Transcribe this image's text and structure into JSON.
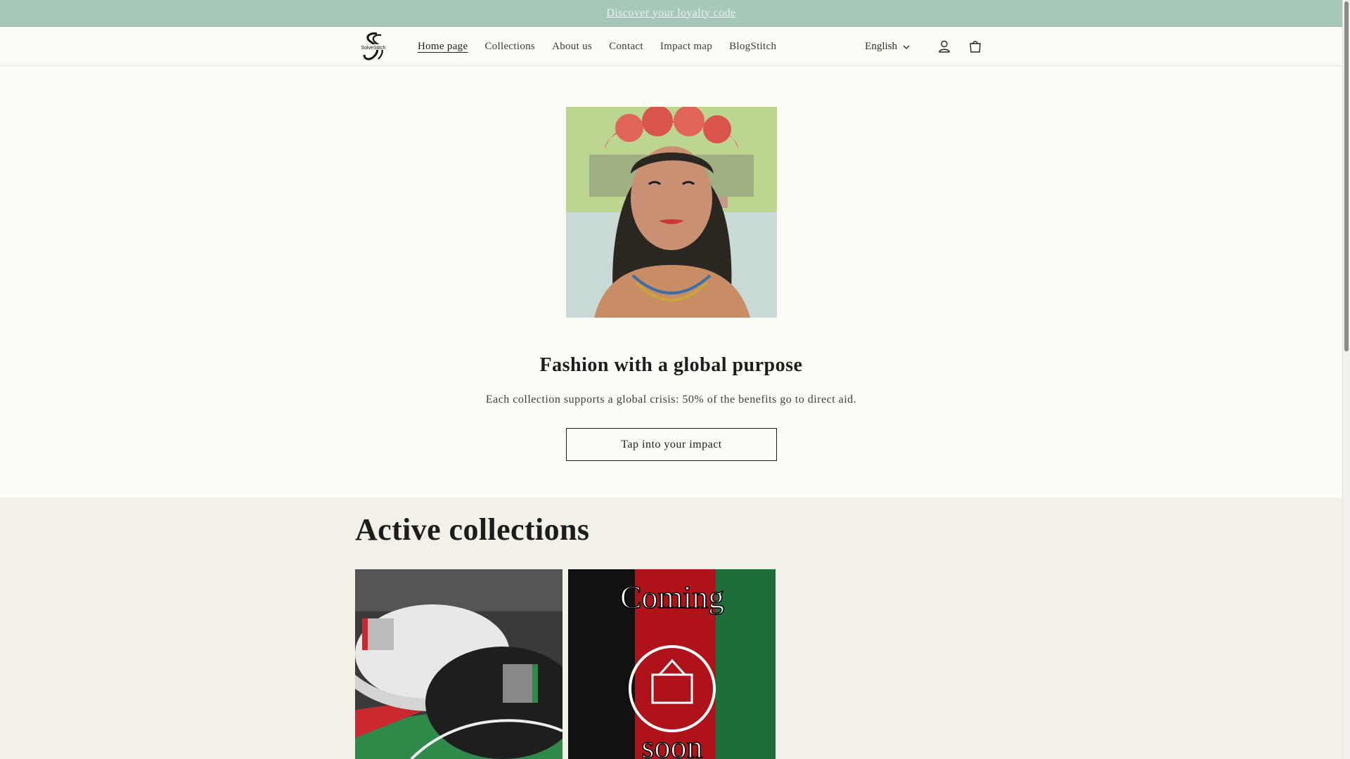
{
  "announcement": {
    "text": "Discover your loyalty code"
  },
  "header": {
    "logo_alt": "SolveStitch",
    "nav": [
      {
        "label": "Home page",
        "active": true
      },
      {
        "label": "Collections",
        "active": false
      },
      {
        "label": "About us",
        "active": false
      },
      {
        "label": "Contact",
        "active": false
      },
      {
        "label": "Impact map",
        "active": false
      },
      {
        "label": "BlogStitch",
        "active": false
      }
    ],
    "language": "English",
    "icons": [
      "account-icon",
      "cart-icon"
    ]
  },
  "hero": {
    "title": "Fashion with a global purpose",
    "subtitle": "Each collection supports a global crisis: 50% of the benefits go to direct aid.",
    "button": "Tap into your impact"
  },
  "collections": {
    "title": "Active collections",
    "cards": [
      {
        "image_desc": "caps"
      },
      {
        "image_text_top": "Coming",
        "image_text_bottom": "soon"
      }
    ]
  },
  "colors": {
    "announcement_bg": "#a6c8b9",
    "header_bg": "#fcfcf7",
    "section_bg": "#f3f0e8",
    "text": "#1c1c1c"
  }
}
